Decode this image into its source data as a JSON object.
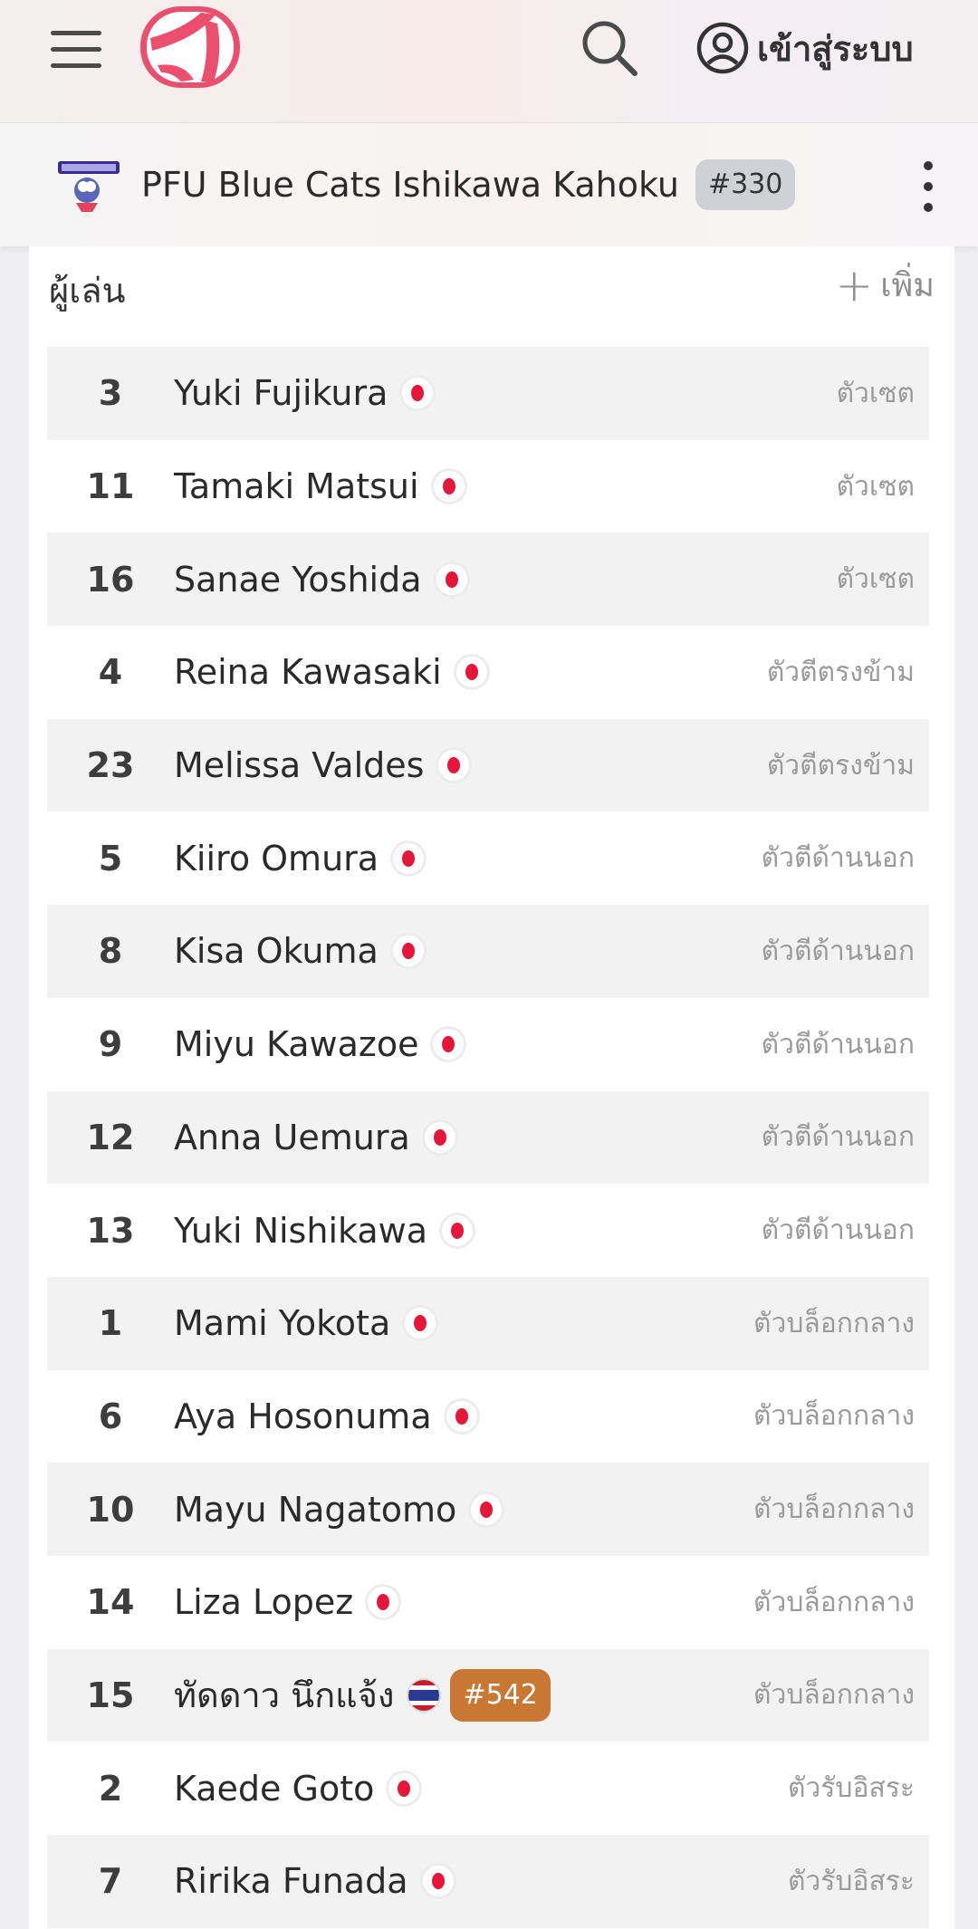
{
  "header": {
    "login_label": "เข้าสู่ระบบ",
    "icons": {
      "menu": "hamburger-menu-icon",
      "logo": "volleyball-logo-icon",
      "search": "search-icon",
      "user": "user-circle-icon"
    }
  },
  "team": {
    "name": "PFU Blue Cats Ishikawa Kahoku",
    "rank": "#330"
  },
  "players_section": {
    "title": "ผู้เล่น",
    "add_label": "เพิ่ม"
  },
  "players": [
    {
      "number": "3",
      "name": "Yuki Fujikura",
      "flag": "jp",
      "position": "ตัวเซต"
    },
    {
      "number": "11",
      "name": "Tamaki Matsui",
      "flag": "jp",
      "position": "ตัวเซต"
    },
    {
      "number": "16",
      "name": "Sanae Yoshida",
      "flag": "jp",
      "position": "ตัวเซต"
    },
    {
      "number": "4",
      "name": "Reina Kawasaki",
      "flag": "jp",
      "position": "ตัวตีตรงข้าม"
    },
    {
      "number": "23",
      "name": "Melissa Valdes",
      "flag": "jp",
      "position": "ตัวตีตรงข้าม"
    },
    {
      "number": "5",
      "name": "Kiiro Omura",
      "flag": "jp",
      "position": "ตัวตีด้านนอก"
    },
    {
      "number": "8",
      "name": "Kisa Okuma",
      "flag": "jp",
      "position": "ตัวตีด้านนอก"
    },
    {
      "number": "9",
      "name": "Miyu Kawazoe",
      "flag": "jp",
      "position": "ตัวตีด้านนอก"
    },
    {
      "number": "12",
      "name": "Anna Uemura",
      "flag": "jp",
      "position": "ตัวตีด้านนอก"
    },
    {
      "number": "13",
      "name": "Yuki Nishikawa",
      "flag": "jp",
      "position": "ตัวตีด้านนอก"
    },
    {
      "number": "1",
      "name": "Mami Yokota",
      "flag": "jp",
      "position": "ตัวบล็อกกลาง"
    },
    {
      "number": "6",
      "name": "Aya Hosonuma",
      "flag": "jp",
      "position": "ตัวบล็อกกลาง"
    },
    {
      "number": "10",
      "name": "Mayu Nagatomo",
      "flag": "jp",
      "position": "ตัวบล็อกกลาง"
    },
    {
      "number": "14",
      "name": "Liza Lopez",
      "flag": "jp",
      "position": "ตัวบล็อกกลาง"
    },
    {
      "number": "15",
      "name": "ทัดดาว นึกแจ้ง",
      "flag": "th",
      "rank": "#542",
      "position": "ตัวบล็อกกลาง"
    },
    {
      "number": "2",
      "name": "Kaede Goto",
      "flag": "jp",
      "position": "ตัวรับอิสระ"
    },
    {
      "number": "7",
      "name": "Ririka Funada",
      "flag": "jp",
      "position": "ตัวรับอิสระ"
    }
  ]
}
